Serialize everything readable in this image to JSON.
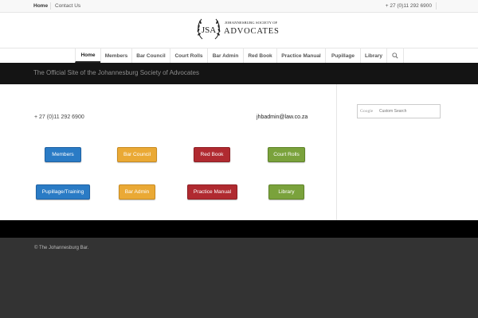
{
  "topbar": {
    "home_label": "Home",
    "contact_label": "Contact Us",
    "phone": "+ 27 (0)11 292 6900"
  },
  "logo": {
    "monogram": "JSA",
    "top_text": "JOHANNESBURG SOCIETY OF",
    "main_text": "ADVOCATES"
  },
  "nav": {
    "items": [
      {
        "label": "Home"
      },
      {
        "label": "Members"
      },
      {
        "label": "Bar Council"
      },
      {
        "label": "Court Rolls"
      },
      {
        "label": "Bar Admin"
      },
      {
        "label": "Red Book"
      },
      {
        "label": "Practice Manual"
      },
      {
        "label": "Pupillage"
      },
      {
        "label": "Library"
      }
    ],
    "search_icon": "search-icon"
  },
  "banner": {
    "tagline": "The Official Site of the Johannesburg Society of Advocates"
  },
  "contact": {
    "phone": "+ 27 (0)11 292 6900",
    "email": "jhbadmin@law.co.za"
  },
  "buttons": {
    "row1": [
      {
        "label": "Members"
      },
      {
        "label": "Bar Council"
      },
      {
        "label": "Red Book"
      },
      {
        "label": "Court Rolls"
      }
    ],
    "row2": [
      {
        "label": "Pupillage/Training"
      },
      {
        "label": "Bar Admin"
      },
      {
        "label": "Practice Manual"
      },
      {
        "label": "Library"
      }
    ]
  },
  "colors": {
    "blue": "#2a7bc5",
    "orange": "#eaa935",
    "red": "#b02a30",
    "green": "#7aa23c"
  },
  "search": {
    "brand": "Google",
    "placeholder": "Custom Search"
  },
  "footer": {
    "copyright": "© The Johannesburg Bar."
  }
}
